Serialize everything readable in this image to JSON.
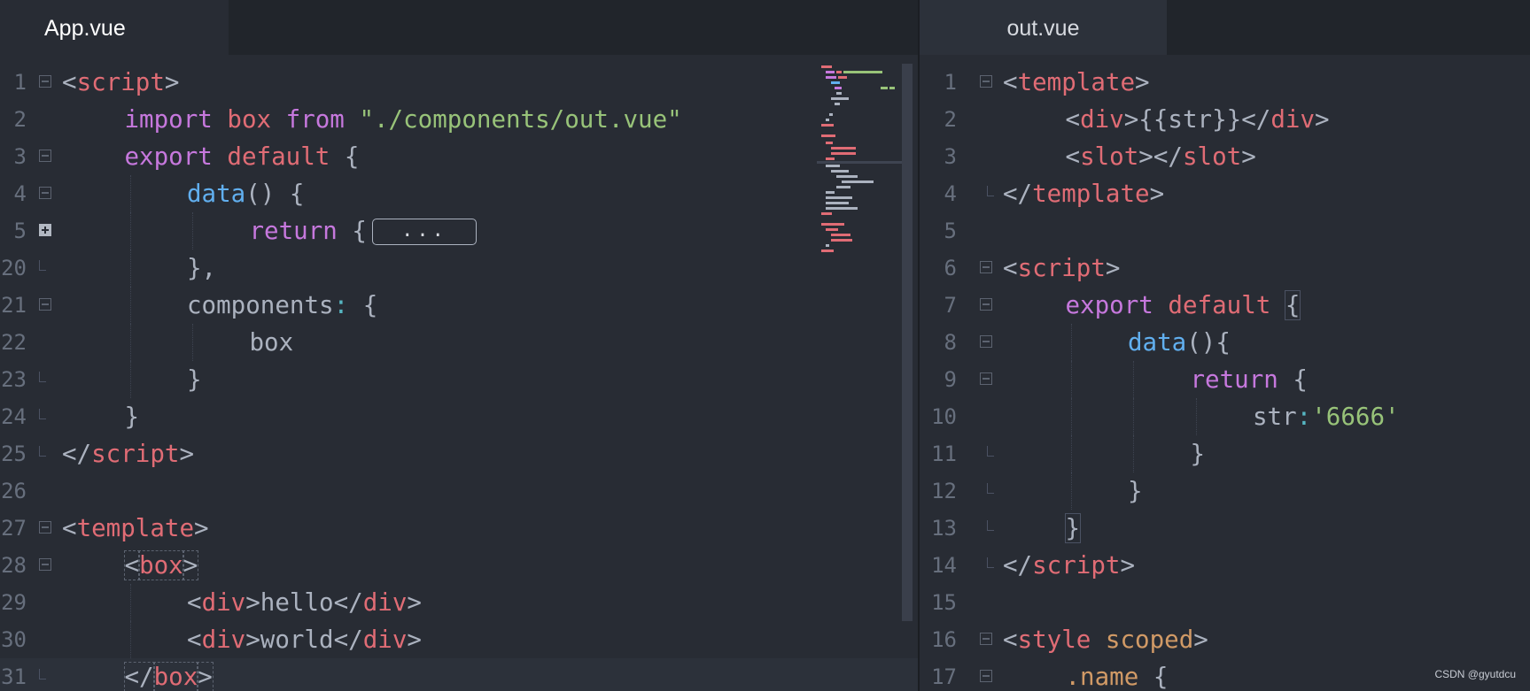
{
  "left_pane": {
    "tab": "App.vue",
    "lines": [
      {
        "n": "1",
        "fold": "open",
        "indent": 0,
        "tokens": [
          [
            "tk-pun",
            "<"
          ],
          [
            "tk-tag",
            "script"
          ],
          [
            "tk-pun",
            ">"
          ]
        ]
      },
      {
        "n": "2",
        "fold": "",
        "indent": 1,
        "tokens": [
          [
            "tk-kw",
            "import"
          ],
          [
            "tk-plain",
            " "
          ],
          [
            "tk-tag",
            "box"
          ],
          [
            "tk-plain",
            " "
          ],
          [
            "tk-kw",
            "from"
          ],
          [
            "tk-plain",
            " "
          ],
          [
            "tk-str",
            "\"./components/out.vue\""
          ]
        ]
      },
      {
        "n": "3",
        "fold": "open",
        "indent": 1,
        "tokens": [
          [
            "tk-kw",
            "export"
          ],
          [
            "tk-plain",
            " "
          ],
          [
            "tk-tag",
            "default"
          ],
          [
            "tk-plain",
            " {"
          ]
        ]
      },
      {
        "n": "4",
        "fold": "open",
        "indent": 2,
        "tokens": [
          [
            "tk-fn",
            "data"
          ],
          [
            "tk-plain",
            "() {"
          ]
        ]
      },
      {
        "n": "5",
        "fold": "closed",
        "indent": 3,
        "tokens": [
          [
            "tk-kw",
            "return"
          ],
          [
            "tk-plain",
            " {"
          ]
        ],
        "folded": "..."
      },
      {
        "n": "20",
        "fold": "end",
        "indent": 2,
        "tokens": [
          [
            "tk-plain",
            "},"
          ]
        ]
      },
      {
        "n": "21",
        "fold": "open",
        "indent": 2,
        "tokens": [
          [
            "tk-plain",
            "components"
          ],
          [
            "tk-op",
            ":"
          ],
          [
            "tk-plain",
            " {"
          ]
        ]
      },
      {
        "n": "22",
        "fold": "",
        "indent": 3,
        "tokens": [
          [
            "tk-plain",
            "box"
          ]
        ]
      },
      {
        "n": "23",
        "fold": "end",
        "indent": 2,
        "tokens": [
          [
            "tk-plain",
            "}"
          ]
        ]
      },
      {
        "n": "24",
        "fold": "end",
        "indent": 1,
        "tokens": [
          [
            "tk-plain",
            "}"
          ]
        ]
      },
      {
        "n": "25",
        "fold": "end",
        "indent": 0,
        "tokens": [
          [
            "tk-pun",
            "</"
          ],
          [
            "tk-tag",
            "script"
          ],
          [
            "tk-pun",
            ">"
          ]
        ]
      },
      {
        "n": "26",
        "fold": "",
        "indent": 0,
        "tokens": []
      },
      {
        "n": "27",
        "fold": "open",
        "indent": 0,
        "tokens": [
          [
            "tk-pun",
            "<"
          ],
          [
            "tk-tag",
            "template"
          ],
          [
            "tk-pun",
            ">"
          ]
        ]
      },
      {
        "n": "28",
        "fold": "open",
        "indent": 1,
        "tokens": [
          [
            "tk-pun hl-box",
            "<"
          ],
          [
            "tk-tag hl-box",
            "box"
          ],
          [
            "tk-pun hl-box",
            ">"
          ]
        ]
      },
      {
        "n": "29",
        "fold": "",
        "indent": 2,
        "tokens": [
          [
            "tk-pun",
            "<"
          ],
          [
            "tk-tag",
            "div"
          ],
          [
            "tk-pun",
            ">"
          ],
          [
            "tk-plain",
            "hello"
          ],
          [
            "tk-pun",
            "</"
          ],
          [
            "tk-tag",
            "div"
          ],
          [
            "tk-pun",
            ">"
          ]
        ]
      },
      {
        "n": "30",
        "fold": "",
        "indent": 2,
        "tokens": [
          [
            "tk-pun",
            "<"
          ],
          [
            "tk-tag",
            "div"
          ],
          [
            "tk-pun",
            ">"
          ],
          [
            "tk-plain",
            "world"
          ],
          [
            "tk-pun",
            "</"
          ],
          [
            "tk-tag",
            "div"
          ],
          [
            "tk-pun",
            ">"
          ]
        ]
      },
      {
        "n": "31",
        "fold": "end",
        "indent": 1,
        "active": true,
        "tokens": [
          [
            "tk-pun hl-box",
            "</"
          ],
          [
            "tk-tag hl-box",
            "box"
          ],
          [
            "tk-pun hl-box",
            ">"
          ]
        ]
      }
    ]
  },
  "right_pane": {
    "tab": "out.vue",
    "lines": [
      {
        "n": "1",
        "fold": "open",
        "indent": 0,
        "tokens": [
          [
            "tk-pun",
            "<"
          ],
          [
            "tk-tag",
            "template"
          ],
          [
            "tk-pun",
            ">"
          ]
        ]
      },
      {
        "n": "2",
        "fold": "",
        "indent": 1,
        "tokens": [
          [
            "tk-pun",
            "<"
          ],
          [
            "tk-tag",
            "div"
          ],
          [
            "tk-pun",
            ">"
          ],
          [
            "tk-plain",
            "{{str}}"
          ],
          [
            "tk-pun",
            "</"
          ],
          [
            "tk-tag",
            "div"
          ],
          [
            "tk-pun",
            ">"
          ]
        ]
      },
      {
        "n": "3",
        "fold": "",
        "indent": 1,
        "tokens": [
          [
            "tk-pun",
            "<"
          ],
          [
            "tk-tag",
            "slot"
          ],
          [
            "tk-pun",
            "></"
          ],
          [
            "tk-tag",
            "slot"
          ],
          [
            "tk-pun",
            ">"
          ]
        ]
      },
      {
        "n": "4",
        "fold": "end",
        "indent": 0,
        "tokens": [
          [
            "tk-pun",
            "</"
          ],
          [
            "tk-tag",
            "template"
          ],
          [
            "tk-pun",
            ">"
          ]
        ]
      },
      {
        "n": "5",
        "fold": "",
        "indent": 0,
        "tokens": []
      },
      {
        "n": "6",
        "fold": "open",
        "indent": 0,
        "tokens": [
          [
            "tk-pun",
            "<"
          ],
          [
            "tk-tag",
            "script"
          ],
          [
            "tk-pun",
            ">"
          ]
        ]
      },
      {
        "n": "7",
        "fold": "open",
        "indent": 1,
        "tokens": [
          [
            "tk-kw",
            "export"
          ],
          [
            "tk-plain",
            " "
          ],
          [
            "tk-tag",
            "default"
          ],
          [
            "tk-plain",
            " "
          ],
          [
            "tk-plain hl-brace",
            "{"
          ]
        ]
      },
      {
        "n": "8",
        "fold": "open",
        "indent": 2,
        "tokens": [
          [
            "tk-fn",
            "data"
          ],
          [
            "tk-plain",
            "(){"
          ]
        ]
      },
      {
        "n": "9",
        "fold": "open",
        "indent": 3,
        "tokens": [
          [
            "tk-kw",
            "return"
          ],
          [
            "tk-plain",
            " {"
          ]
        ]
      },
      {
        "n": "10",
        "fold": "",
        "indent": 4,
        "tokens": [
          [
            "tk-plain",
            "str"
          ],
          [
            "tk-op",
            ":"
          ],
          [
            "tk-str",
            "'6666'"
          ]
        ]
      },
      {
        "n": "11",
        "fold": "end",
        "indent": 3,
        "tokens": [
          [
            "tk-plain",
            "}"
          ]
        ]
      },
      {
        "n": "12",
        "fold": "end",
        "indent": 2,
        "tokens": [
          [
            "tk-plain",
            "}"
          ]
        ]
      },
      {
        "n": "13",
        "fold": "end",
        "indent": 1,
        "tokens": [
          [
            "tk-plain hl-brace",
            "}"
          ]
        ]
      },
      {
        "n": "14",
        "fold": "end",
        "indent": 0,
        "tokens": [
          [
            "tk-pun",
            "</"
          ],
          [
            "tk-tag",
            "script"
          ],
          [
            "tk-pun",
            ">"
          ]
        ]
      },
      {
        "n": "15",
        "fold": "",
        "indent": 0,
        "tokens": []
      },
      {
        "n": "16",
        "fold": "open",
        "indent": 0,
        "tokens": [
          [
            "tk-pun",
            "<"
          ],
          [
            "tk-tag",
            "style"
          ],
          [
            "tk-plain",
            " "
          ],
          [
            "tk-attr",
            "scoped"
          ],
          [
            "tk-pun",
            ">"
          ]
        ]
      },
      {
        "n": "17",
        "fold": "open",
        "indent": 1,
        "tokens": [
          [
            "tk-sel",
            ".name"
          ],
          [
            "tk-plain",
            " {"
          ]
        ]
      }
    ]
  },
  "watermark": "CSDN @gyutdcu",
  "colors": {
    "background": "#282c34",
    "tag": "#e06c75",
    "keyword": "#c678dd",
    "function": "#61afef",
    "string": "#98c379"
  }
}
